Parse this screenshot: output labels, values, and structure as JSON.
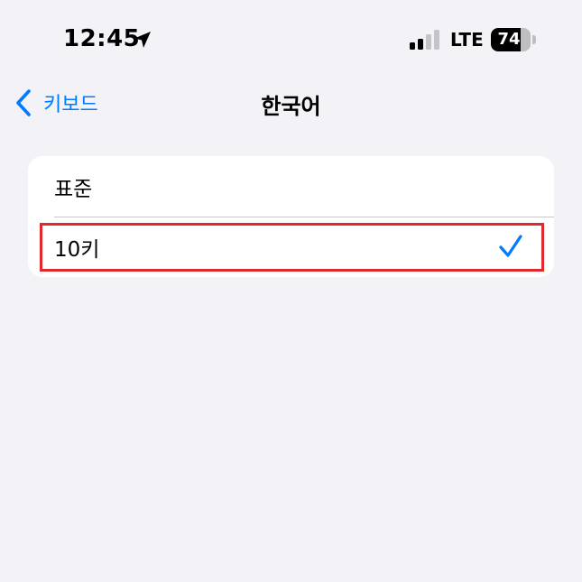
{
  "status_bar": {
    "time": "12:45",
    "network": "LTE",
    "battery_level": "74",
    "battery_fraction": 0.74
  },
  "nav": {
    "back_label": "키보드",
    "title": "한국어"
  },
  "list": {
    "items": [
      {
        "label": "표준",
        "selected": false
      },
      {
        "label": "10키",
        "selected": true
      }
    ]
  },
  "colors": {
    "accent": "#007aff",
    "background": "#f2f2f7",
    "highlight": "#e0282e"
  },
  "icons": {
    "location": "location-arrow-icon",
    "signal": "cellular-signal-icon",
    "battery": "battery-icon",
    "back": "chevron-left-icon",
    "check": "checkmark-icon"
  }
}
